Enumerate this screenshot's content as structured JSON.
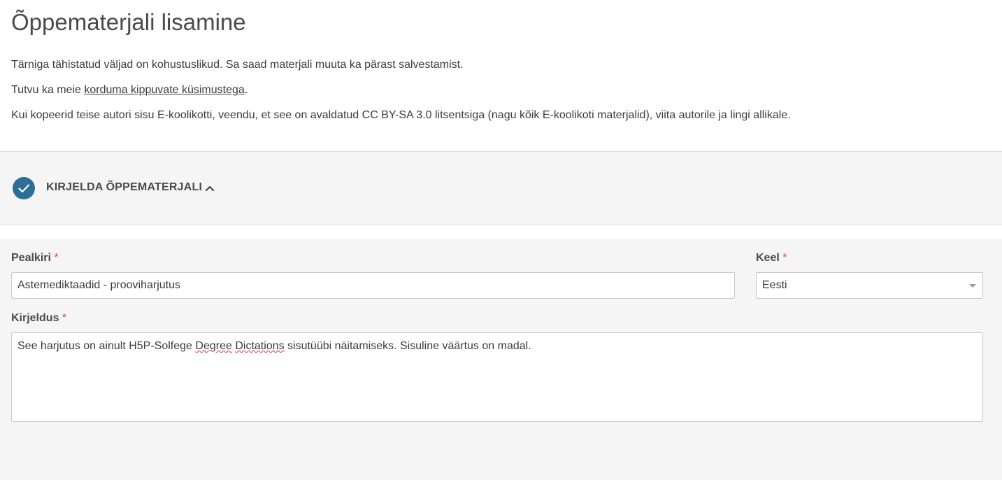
{
  "page": {
    "title": "Õppematerjali lisamine"
  },
  "intro": {
    "line1": "Tärniga tähistatud väljad on kohustuslikud. Sa saad materjali muuta ka pärast salvestamist.",
    "line2_prefix": "Tutvu ka meie ",
    "line2_link": "korduma kippuvate küsimustega",
    "line2_suffix": ".",
    "line3": "Kui kopeerid teise autori sisu E-koolikotti, veendu, et see on avaldatud CC BY-SA 3.0 litsentsiga (nagu kõik E-koolikoti materjalid), viita autorile ja lingi allikale."
  },
  "section": {
    "title": "KIRJELDA ÕPPEMATERJALI",
    "status_icon": "check-circle-icon",
    "toggle_icon": "chevron-up-icon",
    "accent_color": "#2e6e96"
  },
  "form": {
    "required_mark": "*",
    "title_field": {
      "label": "Pealkiri",
      "value": "Astemediktaadid  - prooviharjutus"
    },
    "language_field": {
      "label": "Keel",
      "value": "Eesti"
    },
    "description_field": {
      "label": "Kirjeldus",
      "text_part1": "See harjutus on ainult H5P-Solfege ",
      "text_misspelled1": "Degree",
      "text_space": " ",
      "text_misspelled2": "Dictations",
      "text_part2": " sisutüübi näitamiseks. Sisuline väärtus on madal."
    }
  }
}
